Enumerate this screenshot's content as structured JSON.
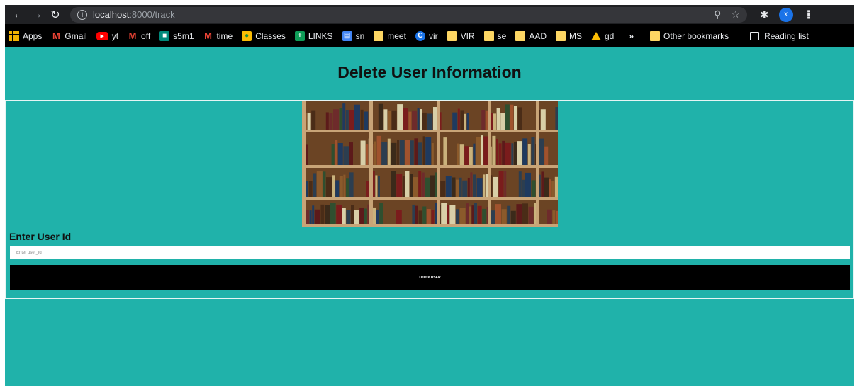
{
  "browser": {
    "url_host": "localhost",
    "url_path": ":8000/track",
    "avatar_initial": "x",
    "icons": {
      "back": "arrow-left-icon",
      "forward": "arrow-right-icon",
      "reload": "reload-icon",
      "info": "info-icon",
      "zoom": "zoom-icon",
      "star": "star-icon",
      "extensions": "puzzle-icon",
      "menu": "kebab-menu-icon"
    }
  },
  "bookmarks": {
    "items": [
      {
        "label": "Apps",
        "icon": "apps-grid-icon"
      },
      {
        "label": "Gmail",
        "icon": "gmail-icon"
      },
      {
        "label": "yt",
        "icon": "youtube-icon"
      },
      {
        "label": "off",
        "icon": "gmail-icon"
      },
      {
        "label": "s5m1",
        "icon": "meet-icon"
      },
      {
        "label": "time",
        "icon": "gmail-icon"
      },
      {
        "label": "Classes",
        "icon": "classroom-icon"
      },
      {
        "label": "LINKS",
        "icon": "sheets-icon"
      },
      {
        "label": "sn",
        "icon": "docs-icon"
      },
      {
        "label": "meet",
        "icon": "folder-icon"
      },
      {
        "label": "vir",
        "icon": "c-icon"
      },
      {
        "label": "VIR",
        "icon": "folder-icon"
      },
      {
        "label": "se",
        "icon": "folder-icon"
      },
      {
        "label": "AAD",
        "icon": "folder-icon"
      },
      {
        "label": "MS",
        "icon": "folder-icon"
      },
      {
        "label": "gd",
        "icon": "drive-icon"
      }
    ],
    "overflow": "»",
    "other": "Other bookmarks",
    "reading_list": "Reading list"
  },
  "page": {
    "title": "Delete User Information",
    "field_label": "Enter User Id",
    "input_placeholder": "Enter user_id",
    "input_value": "",
    "submit_label": "Delete USER",
    "image": "bookshelf-image"
  },
  "colors": {
    "page_bg": "#20b2aa",
    "button_bg": "#000000",
    "chrome_bg": "#202124"
  }
}
